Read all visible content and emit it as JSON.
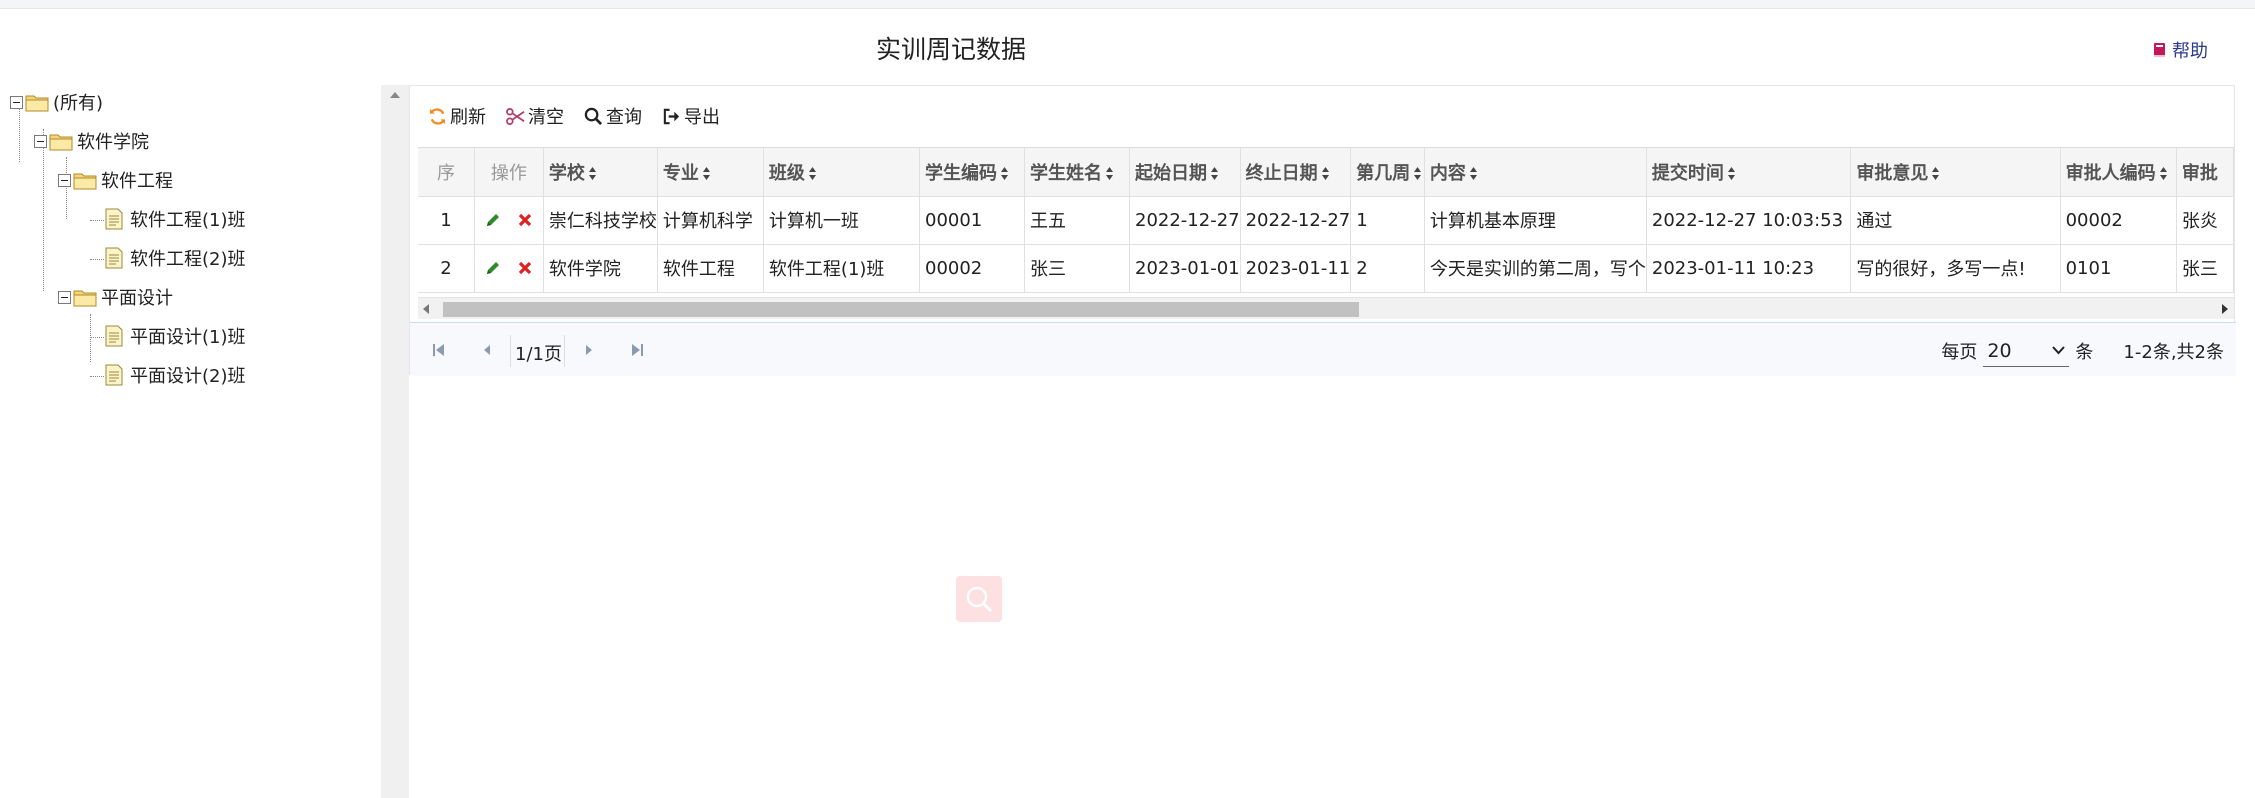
{
  "page": {
    "title": "实训周记数据",
    "help_label": "帮助"
  },
  "tree": {
    "root": "(所有)",
    "college": "软件学院",
    "majors": [
      {
        "label": "软件工程",
        "classes": [
          "软件工程(1)班",
          "软件工程(2)班"
        ]
      },
      {
        "label": "平面设计",
        "classes": [
          "平面设计(1)班",
          "平面设计(2)班"
        ]
      }
    ]
  },
  "toolbar": {
    "refresh": "刷新",
    "clear": "清空",
    "query": "查询",
    "export": "导出"
  },
  "table": {
    "columns": [
      "序",
      "操作",
      "学校",
      "专业",
      "班级",
      "学生编码",
      "学生姓名",
      "起始日期",
      "终止日期",
      "第几周",
      "内容",
      "提交时间",
      "审批意见",
      "审批人编码",
      "审批"
    ],
    "rows": [
      {
        "index": "1",
        "school": "崇仁科技学校",
        "major": "计算机科学",
        "class": "计算机一班",
        "student_code": "00001",
        "student_name": "王五",
        "start_date": "2022-12-27",
        "end_date": "2022-12-27",
        "week": "1",
        "content": "计算机基本原理",
        "submit_time": "2022-12-27 10:03:53",
        "approval": "通过",
        "approver_code": "00002",
        "approver": "张炎"
      },
      {
        "index": "2",
        "school": "软件学院",
        "major": "软件工程",
        "class": "软件工程(1)班",
        "student_code": "00002",
        "student_name": "张三",
        "start_date": "2023-01-01",
        "end_date": "2023-01-11",
        "week": "2",
        "content": "今天是实训的第二周，写个",
        "submit_time": "2023-01-11 10:23",
        "approval": "写的很好，多写一点!",
        "approver_code": "0101",
        "approver": "张三"
      }
    ]
  },
  "pager": {
    "page_info": "1/1页",
    "per_page_label": "每页",
    "per_page_value": "20",
    "unit": "条",
    "range_info": "1-2条,共2条"
  },
  "colors": {
    "accent": "#f28a1e",
    "help": "#2d3a8c",
    "edit": "#2e8b2e",
    "delete": "#e02020"
  },
  "icons": [
    "refresh-icon",
    "scissors-icon",
    "search-icon",
    "export-icon",
    "book-icon",
    "folder-icon",
    "file-icon",
    "edit-icon",
    "delete-icon"
  ]
}
